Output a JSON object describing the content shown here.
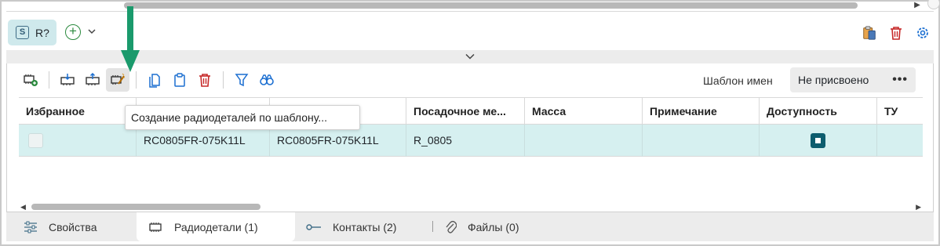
{
  "designator": {
    "badge": "S",
    "label": "R?"
  },
  "add_button": {
    "symbol": "+",
    "chevron": "⌄"
  },
  "top_right_icons": [
    "clipboard-paste-icon",
    "trash-icon",
    "gear-icon"
  ],
  "collapse_chevron": "⌄",
  "toolbar": {
    "buttons": [
      "add-component-icon",
      "import-component-icon",
      "export-component-icon",
      "create-from-template-icon",
      "copy-icon",
      "paste-icon",
      "delete-icon",
      "filter-icon",
      "find-icon"
    ],
    "active_button": "create-from-template-icon"
  },
  "name_template": {
    "label": "Шаблон имен",
    "value": "Не присвоено",
    "more": "•••"
  },
  "tooltip": "Создание радиодеталей по шаблону...",
  "table": {
    "columns": [
      "Избранное",
      "",
      "",
      "Посадочное ме...",
      "Масса",
      "Примечание",
      "Доступность",
      "ТУ"
    ],
    "rows": [
      {
        "favorite": false,
        "col1": "RC0805FR-075K11L",
        "col2": "RC0805FR-075K11L",
        "footprint": "R_0805",
        "mass": "",
        "note": "",
        "available": true,
        "tu": ""
      }
    ]
  },
  "tabs": [
    {
      "label": "Свойства",
      "icon": "sliders-icon",
      "active": false
    },
    {
      "label": "Радиодетали (1)",
      "icon": "chip-icon",
      "active": true
    },
    {
      "label": "Контакты (2)",
      "icon": "pin-icon",
      "active": false
    },
    {
      "label": "Файлы (0)",
      "icon": "paperclip-icon",
      "active": false
    }
  ],
  "colors": {
    "accent_teal": "#0d5d6e",
    "row_selected": "#d6f0f0",
    "chip_bg": "#cfe9ec",
    "annotation_green": "#1a9a6c",
    "delete_red": "#c62828",
    "action_blue": "#1c6fd1"
  }
}
